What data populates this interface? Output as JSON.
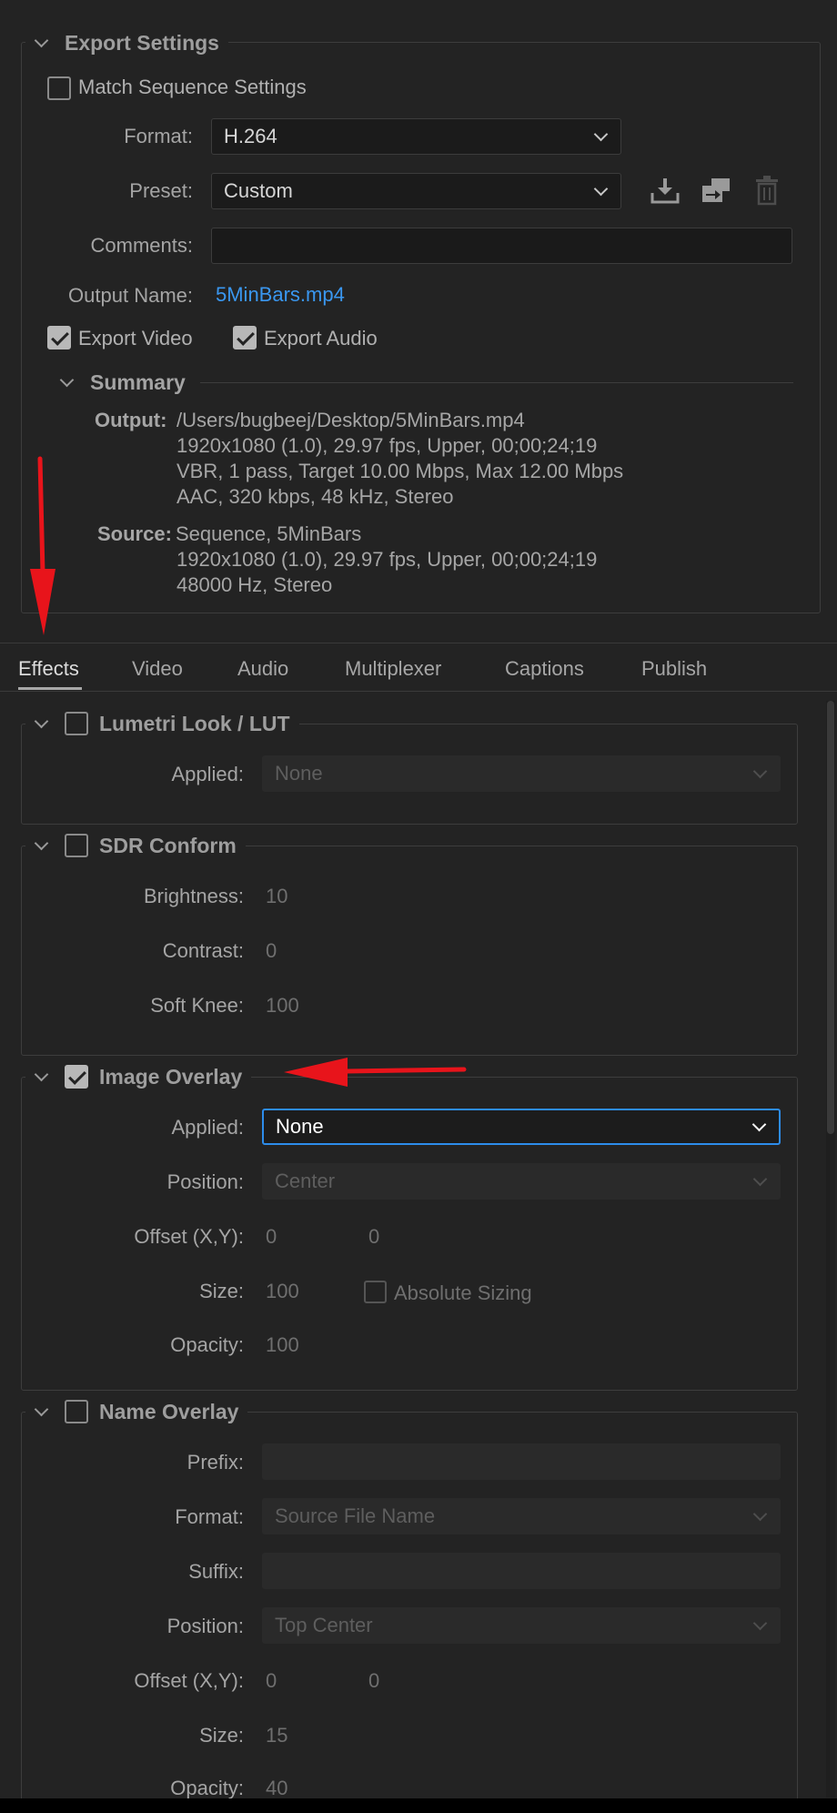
{
  "export_settings": {
    "title": "Export Settings",
    "match_sequence_label": "Match Sequence Settings",
    "match_sequence_checked": false,
    "format_label": "Format:",
    "format_value": "H.264",
    "preset_label": "Preset:",
    "preset_value": "Custom",
    "comments_label": "Comments:",
    "comments_value": "",
    "output_name_label": "Output Name:",
    "output_name_value": "5MinBars.mp4",
    "export_video_label": "Export Video",
    "export_video_checked": true,
    "export_audio_label": "Export Audio",
    "export_audio_checked": true,
    "preset_icons": [
      "save-preset-icon",
      "import-preset-icon",
      "delete-preset-icon"
    ]
  },
  "summary": {
    "title": "Summary",
    "output_key": "Output:",
    "output_lines": [
      "/Users/bugbeej/Desktop/5MinBars.mp4",
      "1920x1080 (1.0), 29.97 fps, Upper, 00;00;24;19",
      "VBR, 1 pass, Target 10.00 Mbps, Max 12.00 Mbps",
      "AAC, 320 kbps, 48 kHz, Stereo"
    ],
    "source_key": "Source:",
    "source_lines": [
      "Sequence, 5MinBars",
      "1920x1080 (1.0), 29.97 fps, Upper, 00;00;24;19",
      "48000 Hz, Stereo"
    ]
  },
  "tabs": [
    {
      "label": "Effects",
      "active": true
    },
    {
      "label": "Video",
      "active": false
    },
    {
      "label": "Audio",
      "active": false
    },
    {
      "label": "Multiplexer",
      "active": false
    },
    {
      "label": "Captions",
      "active": false
    },
    {
      "label": "Publish",
      "active": false
    }
  ],
  "lumetri": {
    "title": "Lumetri Look / LUT",
    "checked": false,
    "applied_label": "Applied:",
    "applied_value": "None"
  },
  "sdr": {
    "title": "SDR Conform",
    "checked": false,
    "brightness_label": "Brightness:",
    "brightness_value": "10",
    "contrast_label": "Contrast:",
    "contrast_value": "0",
    "soft_knee_label": "Soft Knee:",
    "soft_knee_value": "100"
  },
  "image_overlay": {
    "title": "Image Overlay",
    "checked": true,
    "applied_label": "Applied:",
    "applied_value": "None",
    "position_label": "Position:",
    "position_value": "Center",
    "offset_label": "Offset (X,Y):",
    "offset_x": "0",
    "offset_y": "0",
    "size_label": "Size:",
    "size_value": "100",
    "absolute_sizing_label": "Absolute Sizing",
    "opacity_label": "Opacity:",
    "opacity_value": "100"
  },
  "name_overlay": {
    "title": "Name Overlay",
    "checked": false,
    "prefix_label": "Prefix:",
    "prefix_value": "",
    "format_label": "Format:",
    "format_value": "Source File Name",
    "suffix_label": "Suffix:",
    "suffix_value": "",
    "position_label": "Position:",
    "position_value": "Top Center",
    "offset_label": "Offset (X,Y):",
    "offset_x": "0",
    "offset_y": "0",
    "size_label": "Size:",
    "size_value": "15",
    "opacity_label": "Opacity:",
    "opacity_value": "40"
  },
  "colors": {
    "background": "#232323",
    "link": "#3a97f0",
    "focus": "#2d8ceb",
    "annotation_arrow": "#e8141b"
  }
}
